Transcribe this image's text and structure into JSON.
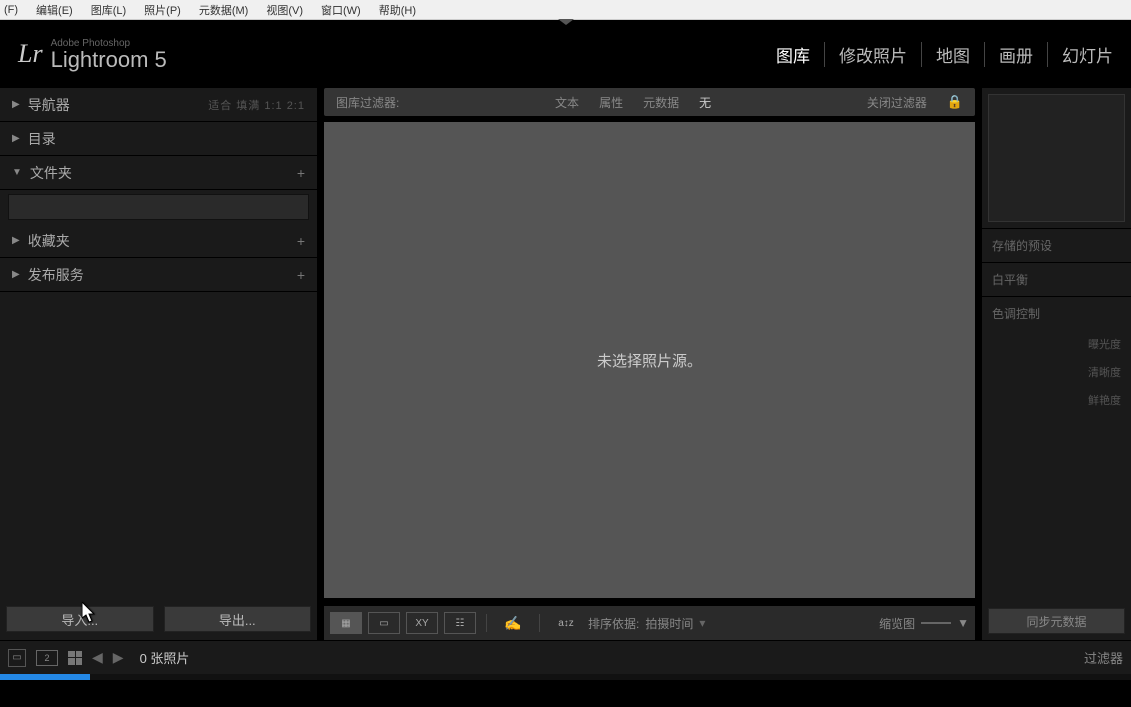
{
  "menubar": [
    "(F)",
    "编辑(E)",
    "图库(L)",
    "照片(P)",
    "元数据(M)",
    "视图(V)",
    "窗口(W)",
    "帮助(H)"
  ],
  "header": {
    "brand_small": "Adobe Photoshop",
    "brand": "Lightroom 5",
    "modules": [
      {
        "label": "图库",
        "active": true
      },
      {
        "label": "修改照片",
        "active": false
      },
      {
        "label": "地图",
        "active": false
      },
      {
        "label": "画册",
        "active": false
      },
      {
        "label": "幻灯片",
        "active": false
      }
    ]
  },
  "left": {
    "sections": [
      {
        "title": "导航器",
        "expanded": false,
        "extra": "适合  填满  1:1  2:1",
        "plus": false
      },
      {
        "title": "目录",
        "expanded": false,
        "plus": false
      },
      {
        "title": "文件夹",
        "expanded": true,
        "plus": true
      },
      {
        "title": "收藏夹",
        "expanded": false,
        "plus": true
      },
      {
        "title": "发布服务",
        "expanded": false,
        "plus": true
      }
    ],
    "import_btn": "导入...",
    "export_btn": "导出..."
  },
  "filter": {
    "label": "图库过滤器:",
    "opts": [
      "文本",
      "属性",
      "元数据",
      "无"
    ],
    "active": 3,
    "close": "关闭过滤器"
  },
  "center": {
    "empty_msg": "未选择照片源。"
  },
  "toolbar": {
    "sort_label": "排序依据:",
    "sort_value": "拍摄时间",
    "zoom_label": "缩览图"
  },
  "right": {
    "sections": [
      "存储的预设",
      "白平衡",
      "色调控制"
    ],
    "subs": [
      "曝光度",
      "清晰度",
      "鲜艳度"
    ],
    "sync_btn": "同步元数据"
  },
  "filmstrip": {
    "count": "0 张照片",
    "filter": "过滤器"
  }
}
